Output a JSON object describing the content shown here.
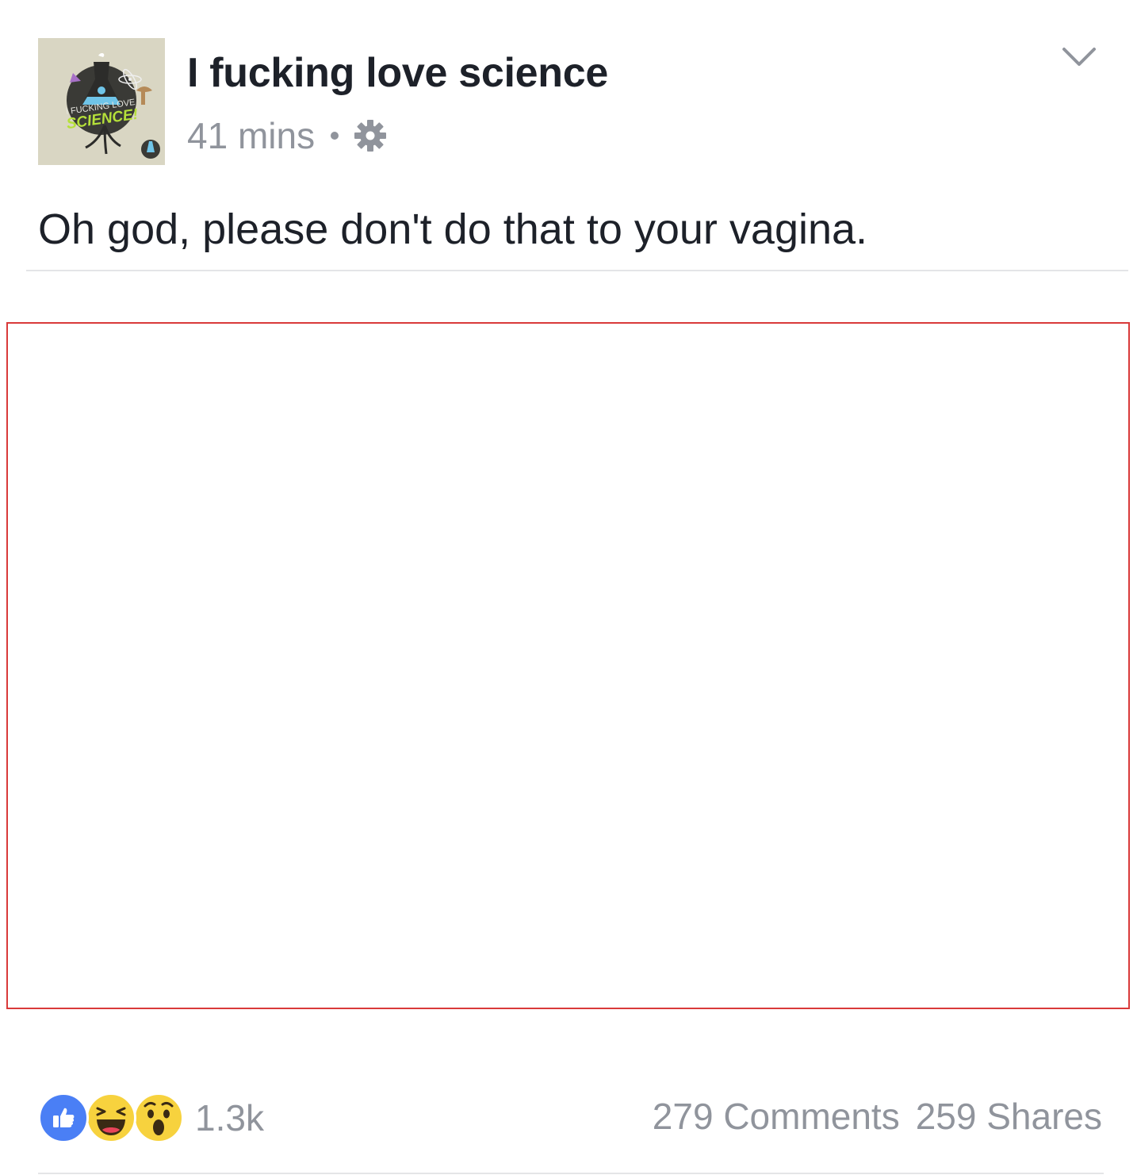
{
  "post": {
    "page_name": "I fucking love science",
    "time": "41 mins",
    "privacy_icon": "gear-icon",
    "menu_icon": "chevron-down-icon",
    "text": "Oh god, please don't do that to your vagina.",
    "avatar": {
      "logo_text_top": "I FUCKING LOVE",
      "logo_text_main": "SCIENCE!",
      "colors": {
        "background": "#d9d6c3",
        "accent": "#b5e03a"
      }
    }
  },
  "engagement": {
    "reaction_icons": [
      "like-icon",
      "haha-icon",
      "wow-icon"
    ],
    "reaction_count": "1.3k",
    "comments": "279 Comments",
    "shares": "259 Shares"
  },
  "colors": {
    "text_primary": "#1d2129",
    "text_secondary": "#90949c",
    "like_blue": "#4a7ff5",
    "reaction_yellow": "#f7d23e",
    "media_border": "#d93a3a"
  }
}
